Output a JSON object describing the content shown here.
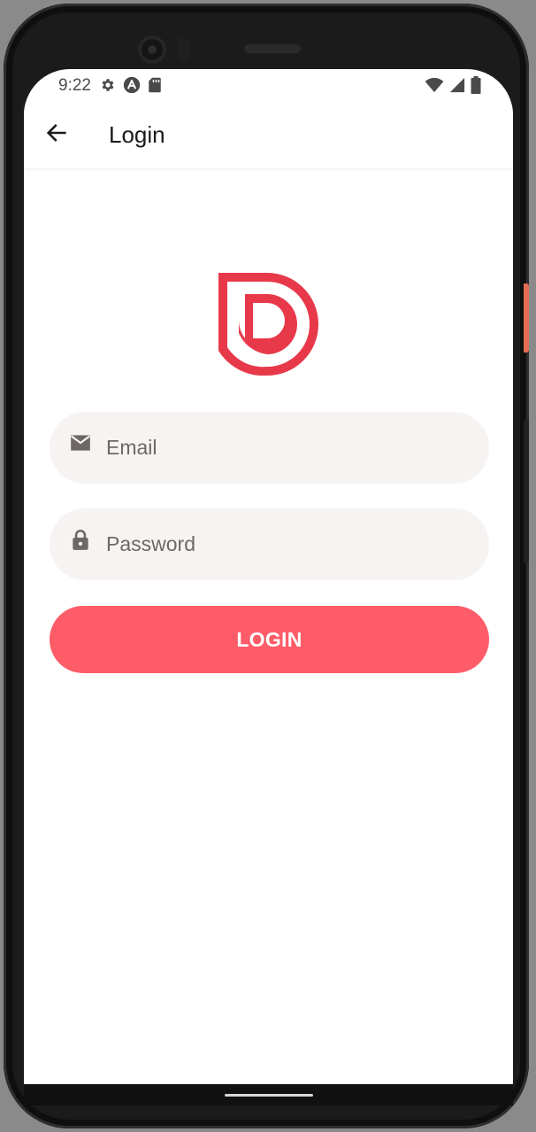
{
  "status_bar": {
    "time": "9:22",
    "left_icons": [
      "gear-icon",
      "a-badge-icon",
      "sd-card-icon"
    ],
    "right_icons": [
      "wifi-icon",
      "signal-icon",
      "battery-icon"
    ]
  },
  "app_bar": {
    "title": "Login",
    "back_icon": "arrow-left-icon"
  },
  "logo": {
    "icon": "d-brand-logo",
    "color": "#e8394a"
  },
  "form": {
    "email": {
      "placeholder": "Email",
      "value": "",
      "icon": "mail-icon"
    },
    "password": {
      "placeholder": "Password",
      "value": "",
      "icon": "lock-icon"
    },
    "submit_label": "LOGIN"
  },
  "colors": {
    "accent": "#fd5c68",
    "field_background": "#f6f3f2",
    "icon": "#6d6867"
  }
}
